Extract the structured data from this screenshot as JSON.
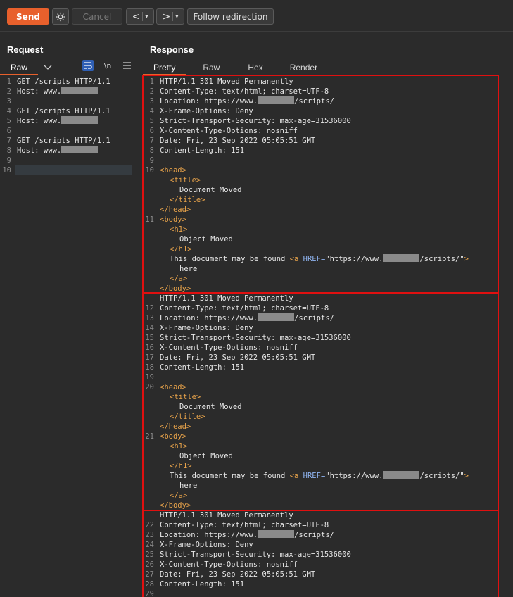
{
  "toolbar": {
    "send_label": "Send",
    "cancel_label": "Cancel",
    "back_glyph": "<",
    "forward_glyph": ">",
    "caret": "▾",
    "follow_label": "Follow redirection",
    "accent_color": "#e8602c"
  },
  "request": {
    "title": "Request",
    "view_tab": "Raw",
    "newline_toggle": "\\n",
    "lines": [
      {
        "n": "1",
        "text": "GET /scripts HTTP/1.1"
      },
      {
        "n": "2",
        "text": "Host: www."
      },
      {
        "n": "3",
        "text": ""
      },
      {
        "n": "4",
        "text": "GET /scripts HTTP/1.1"
      },
      {
        "n": "5",
        "text": "Host: www."
      },
      {
        "n": "6",
        "text": ""
      },
      {
        "n": "7",
        "text": "GET /scripts HTTP/1.1"
      },
      {
        "n": "8",
        "text": "Host: www."
      },
      {
        "n": "9",
        "text": ""
      },
      {
        "n": "10",
        "text": ""
      }
    ]
  },
  "response": {
    "title": "Response",
    "tabs": [
      "Pretty",
      "Raw",
      "Hex",
      "Render"
    ],
    "active_tab": "Pretty",
    "highlight_color": "#e01010",
    "block_a": {
      "status": "HTTP/1.1 301 Moved Permanently",
      "content_type": "Content-Type: text/html; charset=UTF-8",
      "location_prefix": "Location: https://www.",
      "location_suffix": "/scripts/",
      "xfo": "X-Frame-Options: Deny",
      "hsts": "Strict-Transport-Security: max-age=31536000",
      "xcto": "X-Content-Type-Options: nosniff",
      "date": "Date: Fri, 23 Sep 2022 05:05:51 GMT",
      "content_length": "Content-Length: 151"
    },
    "html": {
      "head_open": "<head>",
      "title_open": "<title>",
      "title_text": "Document Moved",
      "title_close": "</title>",
      "head_close": "</head>",
      "body_open": "<body>",
      "h1_open": "<h1>",
      "h1_text": "Object Moved",
      "h1_close": "</h1>",
      "found_text": "This document may be found ",
      "a_open": "<a ",
      "href_attr": "HREF=",
      "href_prefix": "\"https://www.",
      "href_suffix": "/scripts/\"",
      "a_gt": ">",
      "here_text": "here",
      "a_close": "</a>",
      "body_close": "</body>"
    },
    "line_numbers": {
      "block1": [
        "1",
        "2",
        "3",
        "4",
        "5",
        "6",
        "7",
        "8",
        "9",
        "10",
        "11"
      ],
      "block2": [
        "12",
        "13",
        "14",
        "15",
        "16",
        "17",
        "18",
        "19",
        "20",
        "21"
      ],
      "block3": [
        "22",
        "23",
        "24",
        "25",
        "26",
        "27",
        "28",
        "29"
      ]
    }
  }
}
